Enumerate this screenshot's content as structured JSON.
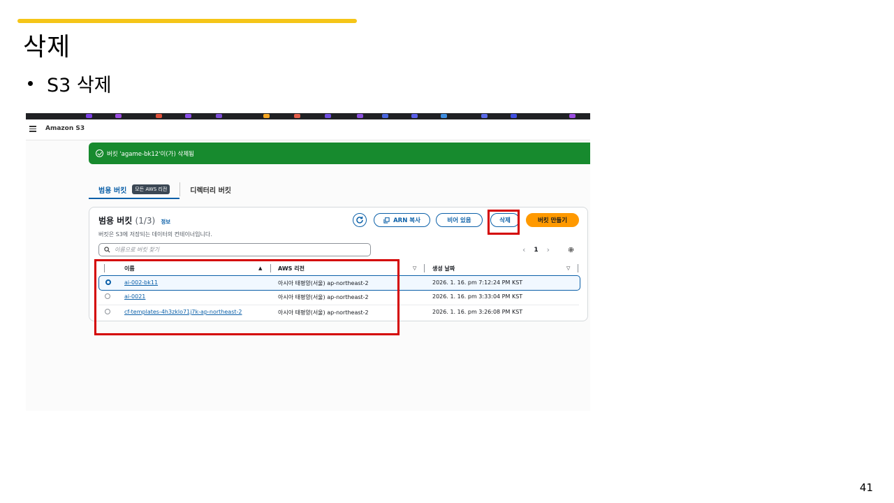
{
  "slide": {
    "title": "삭제",
    "bullet": "S3 삭제",
    "page_number": "41",
    "accent_color": "#f5c518"
  },
  "console": {
    "service_name": "Amazon S3",
    "flash": {
      "message": "버킷 'agame-bk12'이(가) 삭제됨",
      "icon": "check-circle-icon",
      "color": "#178a2e"
    },
    "tabs": [
      {
        "label": "범용 버킷",
        "badge": "모든 AWS 리전",
        "active": true
      },
      {
        "label": "디렉터리 버킷",
        "active": false
      }
    ],
    "panel": {
      "title": "범용 버킷",
      "count": "(1/3)",
      "info": "정보",
      "description": "버킷은 S3에 저장되는 데이터의 컨테이너입니다.",
      "buttons": {
        "copy_arn": "ARN 복사",
        "empty": "비어 있음",
        "delete": "삭제",
        "create": "버킷 만들기"
      },
      "search_placeholder": "이름으로 버킷 찾기",
      "page": "1"
    },
    "table": {
      "columns": [
        "이름",
        "AWS 리전",
        "생성 날짜"
      ],
      "rows": [
        {
          "name": "ai-002-bk11",
          "region": "아시아 태평양(서울) ap-northeast-2",
          "created": "2026. 1. 16. pm 7:12:24 PM KST",
          "selected": true
        },
        {
          "name": "ai-0021",
          "region": "아시아 태평양(서울) ap-northeast-2",
          "created": "2026. 1. 16. pm 3:33:04 PM KST",
          "selected": false
        },
        {
          "name": "cf-templates-4h3zklo71j7k-ap-northeast-2",
          "region": "아시아 태평양(서울) ap-northeast-2",
          "created": "2026. 1. 16. pm 3:26:08 PM KST",
          "selected": false
        }
      ]
    },
    "colors": {
      "link": "#0a5fa8",
      "primary_button": "#ff9900",
      "highlight_box": "#d40000"
    }
  }
}
